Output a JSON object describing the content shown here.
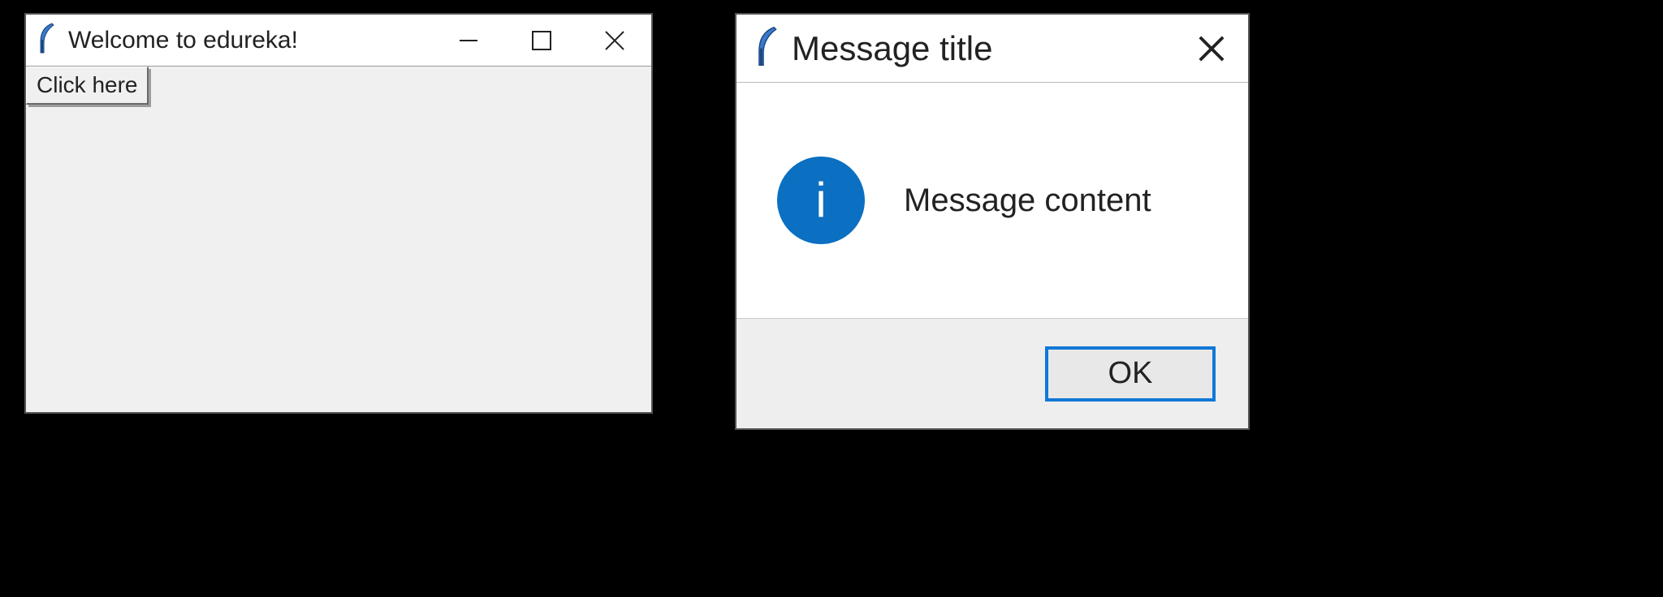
{
  "main_window": {
    "title": "Welcome to edureka!",
    "button_label": "Click here"
  },
  "message_box": {
    "title": "Message title",
    "content": "Message content",
    "ok_label": "OK"
  },
  "icons": {
    "app": "feather-icon",
    "minimize": "minimize-icon",
    "maximize": "maximize-icon",
    "close": "close-icon",
    "info": "info-icon"
  },
  "colors": {
    "info_blue": "#0b6fc2",
    "accent_blue": "#1178d7",
    "client_bg": "#f0f0f0",
    "footer_bg": "#eeeeee"
  }
}
